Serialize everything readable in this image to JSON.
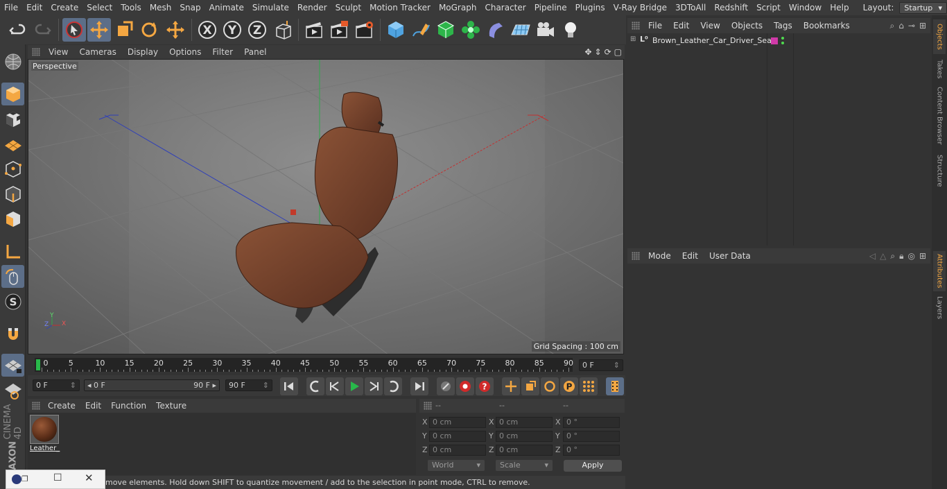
{
  "menubar": {
    "items": [
      "File",
      "Edit",
      "Create",
      "Select",
      "Tools",
      "Mesh",
      "Snap",
      "Animate",
      "Simulate",
      "Render",
      "Sculpt",
      "Motion Tracker",
      "MoGraph",
      "Character",
      "Pipeline",
      "Plugins",
      "V-Ray Bridge",
      "3DToAll",
      "Redshift",
      "Script",
      "Window",
      "Help"
    ],
    "layout_label": "Layout:",
    "layout_value": "Startup"
  },
  "viewport": {
    "menu": [
      "View",
      "Cameras",
      "Display",
      "Options",
      "Filter",
      "Panel"
    ],
    "label": "Perspective",
    "grid_spacing": "Grid Spacing : 100 cm",
    "axis_labels": {
      "y": "Y",
      "z": "Z",
      "x": "X"
    }
  },
  "timeline": {
    "ticks": [
      "0",
      "5",
      "10",
      "15",
      "20",
      "25",
      "30",
      "35",
      "40",
      "45",
      "50",
      "55",
      "60",
      "65",
      "70",
      "75",
      "80",
      "85",
      "90"
    ],
    "current_frame": "0 F",
    "start_field": "0 F",
    "range_start": "0 F",
    "range_end": "90 F",
    "end_field": "90 F"
  },
  "material_panel": {
    "menu": [
      "Create",
      "Edit",
      "Function",
      "Texture"
    ],
    "materials": [
      {
        "name": "Leather_",
        "color": "#6b3a22"
      }
    ]
  },
  "coordinates": {
    "headers": [
      "--",
      "--",
      "--"
    ],
    "rows": [
      {
        "axis": "X",
        "pos": "0 cm",
        "size": "0 cm",
        "rot": "0 °"
      },
      {
        "axis": "Y",
        "pos": "0 cm",
        "size": "0 cm",
        "rot": "0 °"
      },
      {
        "axis": "Z",
        "pos": "0 cm",
        "size": "0 cm",
        "rot": "0 °"
      }
    ],
    "mode_select": "World",
    "scale_select": "Scale",
    "apply_label": "Apply"
  },
  "status": {
    "text": "move elements. Hold down SHIFT to quantize movement / add to the selection in point mode, CTRL to remove."
  },
  "objects_panel": {
    "menu": [
      "File",
      "Edit",
      "View",
      "Objects",
      "Tags",
      "Bookmarks"
    ],
    "objects": [
      {
        "name": "Brown_Leather_Car_Driver_Seat",
        "tag_color": "#d03aa8"
      }
    ]
  },
  "attributes_panel": {
    "menu": [
      "Mode",
      "Edit",
      "User Data"
    ]
  },
  "right_tabs": [
    "Objects",
    "Takes",
    "Content Browser",
    "Structure",
    "Attributes",
    "Layers"
  ],
  "branding": {
    "line1": "MAXON",
    "line2": "CINEMA 4D"
  },
  "colors": {
    "accent": "#f4a742",
    "selected": "#5c6e88",
    "x_axis": "#c23030",
    "y_axis": "#2fa84a",
    "z_axis": "#3040b8",
    "play": "#28b84a"
  }
}
